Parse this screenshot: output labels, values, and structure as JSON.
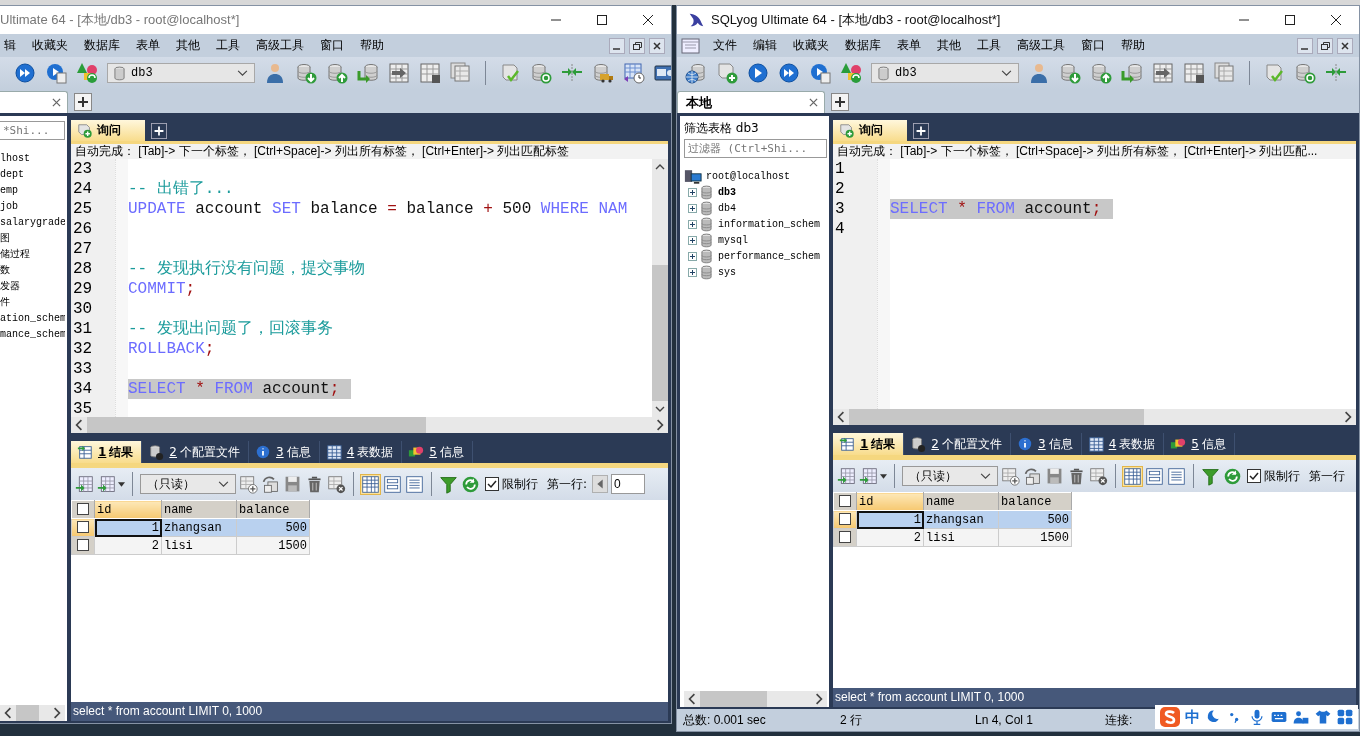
{
  "windows": [
    {
      "title": "Ultimate 64 - [本地/db3 - root@localhost*]",
      "active": false,
      "app_icon": false,
      "menu": [
        "辑",
        "收藏夹",
        "数据库",
        "表单",
        "其他",
        "工具",
        "高级工具",
        "窗口",
        "帮助"
      ],
      "toolbar": [
        {
          "kind": "play2"
        },
        {
          "kind": "play-doc"
        },
        {
          "kind": "shapes"
        },
        {
          "kind": "database-select",
          "value": "db3"
        },
        {
          "kind": "user"
        },
        {
          "kind": "db-down"
        },
        {
          "kind": "db-up"
        },
        {
          "kind": "db-arrow"
        },
        {
          "kind": "grid-arrow"
        },
        {
          "kind": "grid-calc"
        },
        {
          "kind": "grid-multi"
        },
        {
          "kind": "separator"
        },
        {
          "kind": "scroll-check"
        },
        {
          "kind": "db-sync"
        },
        {
          "kind": "merge"
        },
        {
          "kind": "db-truck"
        },
        {
          "kind": "schedule"
        },
        {
          "kind": "card"
        }
      ],
      "connection_tab": {
        "closable": true
      },
      "sidebar": {
        "filter_placeholder": "*Shi...",
        "tree": [
          {
            "label": "lhost",
            "kind": "label"
          },
          {
            "label": "dept",
            "kind": "label"
          },
          {
            "label": "emp",
            "kind": "label"
          },
          {
            "label": "job",
            "kind": "label"
          },
          {
            "label": "salarygrade",
            "kind": "label"
          },
          {
            "label": "图",
            "kind": "label"
          },
          {
            "label": "储过程",
            "kind": "label"
          },
          {
            "label": "数",
            "kind": "label"
          },
          {
            "label": "发器",
            "kind": "label"
          },
          {
            "label": "件",
            "kind": "label"
          },
          {
            "label": "ation_schem",
            "kind": "label"
          },
          {
            "label": "mance_schem",
            "kind": "label"
          }
        ]
      },
      "query_tab": "询问",
      "autocomplete_hint": "自动完成： [Tab]-> 下一个标签， [Ctrl+Space]-> 列出所有标签， [Ctrl+Enter]-> 列出匹配标签",
      "editor": {
        "lines": [
          {
            "number": "23"
          },
          {
            "number": "24",
            "tokens": [
              {
                "kind": "comment",
                "text": "-- 出错了..."
              }
            ]
          },
          {
            "number": "25",
            "tokens": [
              {
                "kind": "keyword",
                "text": "UPDATE"
              },
              {
                "kind": "plain",
                "text": " account"
              },
              {
                "kind": "keyword",
                "text": " SET"
              },
              {
                "kind": "plain",
                "text": " balance"
              },
              {
                "kind": "operator",
                "text": " ="
              },
              {
                "kind": "plain",
                "text": " balance"
              },
              {
                "kind": "operator",
                "text": " +"
              },
              {
                "kind": "plain",
                "text": " 500"
              },
              {
                "kind": "keyword",
                "text": " WHERE"
              },
              {
                "kind": "keyword",
                "text": " NAM"
              }
            ]
          },
          {
            "number": "26"
          },
          {
            "number": "27"
          },
          {
            "number": "28",
            "tokens": [
              {
                "kind": "comment",
                "text": "-- 发现执行没有问题，提交事物"
              }
            ]
          },
          {
            "number": "29",
            "tokens": [
              {
                "kind": "keyword",
                "text": "COMMIT"
              },
              {
                "kind": "operator",
                "text": ";"
              }
            ]
          },
          {
            "number": "30"
          },
          {
            "number": "31",
            "tokens": [
              {
                "kind": "comment",
                "text": "-- 发现出问题了，回滚事务"
              }
            ]
          },
          {
            "number": "32",
            "tokens": [
              {
                "kind": "keyword",
                "text": "ROLLBACK"
              },
              {
                "kind": "operator",
                "text": ";"
              }
            ]
          },
          {
            "number": "33"
          },
          {
            "number": "34",
            "highlighted": true,
            "tokens": [
              {
                "kind": "keyword",
                "text": "SELECT"
              },
              {
                "kind": "operator",
                "text": " *"
              },
              {
                "kind": "keyword",
                "text": " FROM"
              },
              {
                "kind": "plain",
                "text": " account"
              },
              {
                "kind": "operator",
                "text": ";"
              }
            ]
          },
          {
            "number": "35"
          }
        ]
      },
      "result_tabs": [
        {
          "number": "1",
          "label": "结果",
          "selected": true
        },
        {
          "number": "2",
          "label": "个配置文件",
          "selected": false
        },
        {
          "number": "3",
          "label": "信息",
          "selected": false
        },
        {
          "number": "4",
          "label": "表数据",
          "selected": false
        },
        {
          "number": "5",
          "label": "信息",
          "selected": false
        }
      ],
      "result_toolbar": {
        "mode": "（只读）",
        "limit_checked": true,
        "limit_label": "限制行",
        "first_row_label": "第一行:",
        "first_row_value": "0"
      },
      "grid": {
        "all_checked": false,
        "columns": [
          {
            "label": "id",
            "kind": "number"
          },
          {
            "label": "name",
            "kind": "text"
          },
          {
            "label": "balance",
            "kind": "number"
          }
        ],
        "rows": [
          {
            "selected": true,
            "checked": false,
            "cells": [
              "1",
              "zhangsan",
              "500"
            ]
          },
          {
            "selected": false,
            "checked": false,
            "cells": [
              "2",
              "lisi",
              "1500"
            ]
          }
        ]
      },
      "query_status": "select * from account LIMIT 0, 1000"
    },
    {
      "title": "SQLyog Ultimate 64 - [本地/db3 - root@localhost*]",
      "active": true,
      "app_icon": true,
      "menu": [
        "文件",
        "编辑",
        "收藏夹",
        "数据库",
        "表单",
        "其他",
        "工具",
        "高级工具",
        "窗口",
        "帮助"
      ],
      "toolbar": [
        {
          "kind": "db-connect"
        },
        {
          "kind": "scroll-plus"
        },
        {
          "kind": "play"
        },
        {
          "kind": "play2"
        },
        {
          "kind": "play-doc"
        },
        {
          "kind": "shapes"
        },
        {
          "kind": "database-select",
          "value": "db3"
        },
        {
          "kind": "user"
        },
        {
          "kind": "db-down"
        },
        {
          "kind": "db-up"
        },
        {
          "kind": "db-arrow"
        },
        {
          "kind": "grid-arrow"
        },
        {
          "kind": "grid-calc"
        },
        {
          "kind": "grid-multi"
        },
        {
          "kind": "separator"
        },
        {
          "kind": "scroll-check"
        },
        {
          "kind": "db-sync"
        },
        {
          "kind": "merge"
        }
      ],
      "connection_tab": {
        "label": "本地",
        "closable": true
      },
      "sidebar": {
        "filter_label": "筛选表格 db3",
        "filter_placeholder": "过滤器 (Ctrl+Shi...",
        "tree": [
          {
            "label": "root@localhost",
            "kind": "server",
            "children": [
              {
                "label": "db3",
                "kind": "database",
                "expanded": false,
                "selected": true
              },
              {
                "label": "db4",
                "kind": "database",
                "expanded": false,
                "selected": false
              },
              {
                "label": "information_schem",
                "kind": "database",
                "expanded": false,
                "selected": false
              },
              {
                "label": "mysql",
                "kind": "database",
                "expanded": false,
                "selected": false
              },
              {
                "label": "performance_schem",
                "kind": "database",
                "expanded": false,
                "selected": false
              },
              {
                "label": "sys",
                "kind": "database",
                "expanded": false,
                "selected": false
              }
            ]
          }
        ]
      },
      "query_tab": "询问",
      "autocomplete_hint": "自动完成： [Tab]-> 下一个标签， [Ctrl+Space]-> 列出所有标签， [Ctrl+Enter]-> 列出匹配...",
      "editor": {
        "lines": [
          {
            "number": "1"
          },
          {
            "number": "2"
          },
          {
            "number": "3",
            "highlighted": true,
            "tokens": [
              {
                "kind": "keyword",
                "text": "SELECT"
              },
              {
                "kind": "operator",
                "text": " *"
              },
              {
                "kind": "keyword",
                "text": " FROM"
              },
              {
                "kind": "plain",
                "text": " account"
              },
              {
                "kind": "operator",
                "text": ";"
              }
            ]
          },
          {
            "number": "4"
          }
        ]
      },
      "result_tabs": [
        {
          "number": "1",
          "label": "结果",
          "selected": true
        },
        {
          "number": "2",
          "label": "个配置文件",
          "selected": false
        },
        {
          "number": "3",
          "label": "信息",
          "selected": false
        },
        {
          "number": "4",
          "label": "表数据",
          "selected": false
        },
        {
          "number": "5",
          "label": "信息",
          "selected": false
        }
      ],
      "result_toolbar": {
        "mode": "（只读）",
        "limit_checked": true,
        "limit_label": "限制行",
        "first_row_label": "第一行"
      },
      "grid": {
        "all_checked": false,
        "columns": [
          {
            "label": "id",
            "kind": "number"
          },
          {
            "label": "name",
            "kind": "text"
          },
          {
            "label": "balance",
            "kind": "number"
          }
        ],
        "rows": [
          {
            "selected": true,
            "checked": false,
            "cells": [
              "1",
              "zhangsan",
              "500"
            ]
          },
          {
            "selected": false,
            "checked": false,
            "cells": [
              "2",
              "lisi",
              "1500"
            ]
          }
        ]
      },
      "query_status": "select * from account LIMIT 0, 1000",
      "status_bar": [
        "总数: 0.001 sec",
        "2 行",
        "Ln 4, Col 1",
        "连接:"
      ]
    }
  ],
  "ime_bar": {
    "mode": "中"
  }
}
